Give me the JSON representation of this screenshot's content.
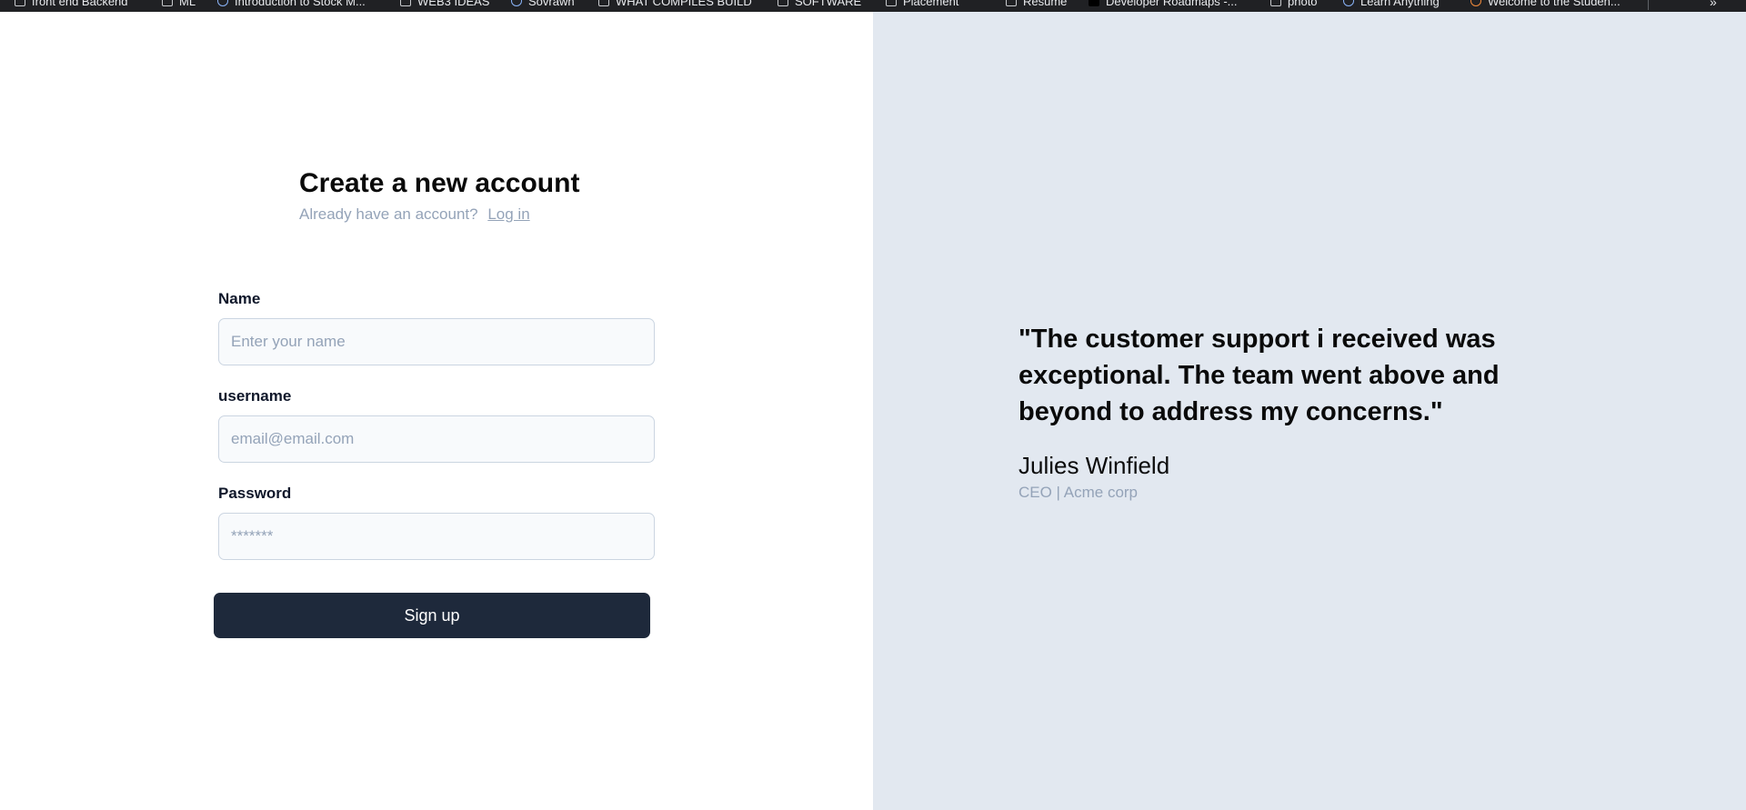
{
  "bookmarks": [
    {
      "label": "front end Backend",
      "icon": "folder-icon"
    },
    {
      "label": "ML",
      "icon": "folder-icon"
    },
    {
      "label": "Introduction to Stock M...",
      "icon": "globe-icon"
    },
    {
      "label": "WEB3 IDEAS",
      "icon": "folder-icon"
    },
    {
      "label": "Sovrawn",
      "icon": "site-icon"
    },
    {
      "label": "WHAT COMPILES BUILD",
      "icon": "folder-icon"
    },
    {
      "label": "SOFTWARE",
      "icon": "folder-icon"
    },
    {
      "label": "Placement",
      "icon": "folder-icon"
    },
    {
      "label": "Resume",
      "icon": "folder-icon"
    },
    {
      "label": "Developer Roadmaps -...",
      "icon": "roadmap-icon"
    },
    {
      "label": "photo",
      "icon": "folder-icon"
    },
    {
      "label": "Learn Anything",
      "icon": "globe-icon"
    },
    {
      "label": "Welcome to the Studen...",
      "icon": "site-icon"
    }
  ],
  "signup": {
    "title": "Create a new account",
    "subtitle": "Already have an account?",
    "login_link": "Log in",
    "fields": {
      "name": {
        "label": "Name",
        "placeholder": "Enter your name",
        "value": ""
      },
      "username": {
        "label": "username",
        "placeholder": "email@email.com",
        "value": ""
      },
      "password": {
        "label": "Password",
        "placeholder": "*******",
        "value": ""
      }
    },
    "submit_label": "Sign up"
  },
  "testimonial": {
    "quote": "\"The customer support i received was exceptional. The team went above and beyond to address my concerns.\"",
    "author": "Julies Winfield",
    "author_title": "CEO | Acme corp"
  },
  "colors": {
    "right_panel_bg": "#e2e8f0",
    "button_bg": "#1e293b",
    "muted_text": "#94a3b8"
  }
}
